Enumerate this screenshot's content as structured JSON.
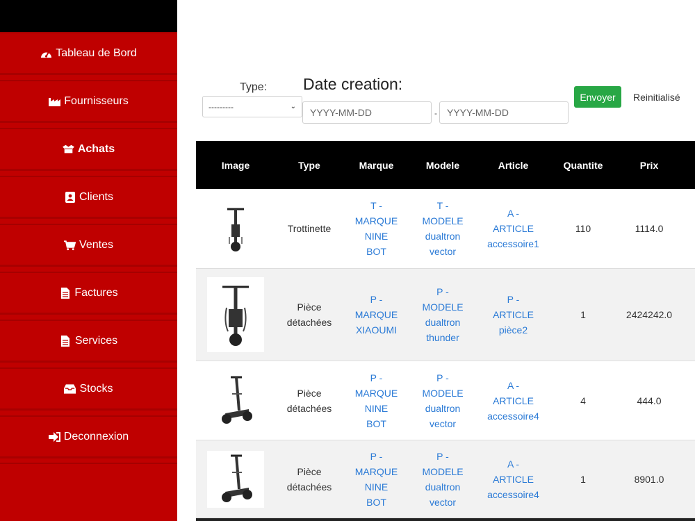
{
  "sidebar": {
    "items": [
      {
        "label": "Tableau de Bord",
        "icon": "dashboard-icon",
        "active": false
      },
      {
        "label": "Fournisseurs",
        "icon": "industry-icon",
        "active": false
      },
      {
        "label": "Achats",
        "icon": "box-open-icon",
        "active": true
      },
      {
        "label": "Clients",
        "icon": "contact-card-icon",
        "active": false
      },
      {
        "label": "Ventes",
        "icon": "shopping-cart-icon",
        "active": false
      },
      {
        "label": "Factures",
        "icon": "file-invoice-icon",
        "active": false
      },
      {
        "label": "Services",
        "icon": "file-alt-icon",
        "active": false
      },
      {
        "label": "Stocks",
        "icon": "inbox-icon",
        "active": false
      },
      {
        "label": "Deconnexion",
        "icon": "sign-out-icon",
        "active": false
      }
    ]
  },
  "filters": {
    "type_label": "Type:",
    "type_value": "---------",
    "date_label": "Date creation:",
    "date_from_placeholder": "YYYY-MM-DD",
    "date_to_placeholder": "YYYY-MM-DD",
    "date_separator": "-",
    "send_label": "Envoyer",
    "reset_label": "Reinitialisé"
  },
  "table": {
    "headers": [
      "Image",
      "Type",
      "Marque",
      "Modele",
      "Article",
      "Quantite",
      "Prix"
    ],
    "rows": [
      {
        "type": [
          "Trottinette"
        ],
        "marque": [
          "T -",
          "MARQUE",
          "NINE",
          "BOT"
        ],
        "modele": [
          "T -",
          "MODELE",
          "dualtron",
          "vector"
        ],
        "article": [
          "A -",
          "ARTICLE",
          "accessoire1"
        ],
        "quantite": "110",
        "prix": "1114.0"
      },
      {
        "type": [
          "Pièce",
          "détachées"
        ],
        "marque": [
          "P -",
          "MARQUE",
          "XIAOUMI"
        ],
        "modele": [
          "P -",
          "MODELE",
          "dualtron",
          "thunder"
        ],
        "article": [
          "P -",
          "ARTICLE",
          "pièce2"
        ],
        "quantite": "1",
        "prix": "2424242.0"
      },
      {
        "type": [
          "Pièce",
          "détachées"
        ],
        "marque": [
          "P -",
          "MARQUE",
          "NINE",
          "BOT"
        ],
        "modele": [
          "P -",
          "MODELE",
          "dualtron",
          "vector"
        ],
        "article": [
          "A -",
          "ARTICLE",
          "accessoire4"
        ],
        "quantite": "4",
        "prix": "444.0"
      },
      {
        "type": [
          "Pièce",
          "détachées"
        ],
        "marque": [
          "P -",
          "MARQUE",
          "NINE",
          "BOT"
        ],
        "modele": [
          "P -",
          "MODELE",
          "dualtron",
          "vector"
        ],
        "article": [
          "A -",
          "ARTICLE",
          "accessoire4"
        ],
        "quantite": "1",
        "prix": "8901.0"
      }
    ]
  },
  "colors": {
    "sidebar": "#c00000",
    "accent_link": "#2a7ad6",
    "button": "#28a745",
    "header": "#000000"
  }
}
